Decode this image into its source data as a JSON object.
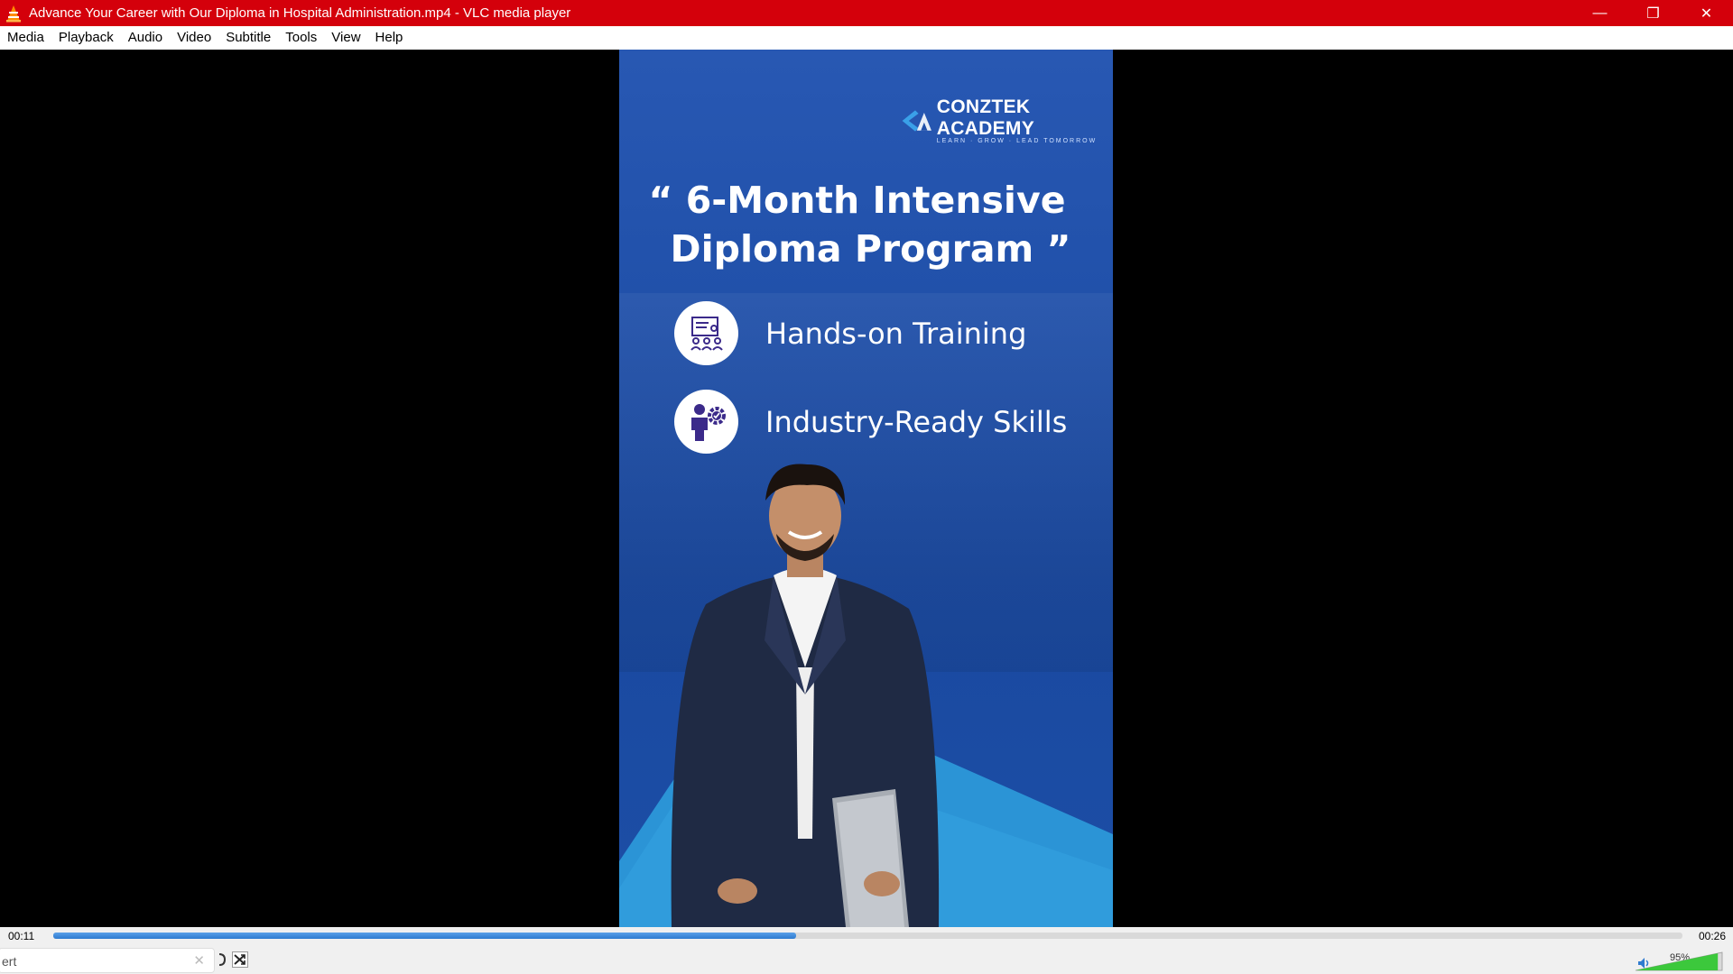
{
  "window": {
    "title": "Advance Your Career with Our Diploma in Hospital Administration.mp4 - VLC media player",
    "controls": {
      "minimize": "—",
      "restore": "❐",
      "close": "✕"
    }
  },
  "menu": [
    "Media",
    "Playback",
    "Audio",
    "Video",
    "Subtitle",
    "Tools",
    "View",
    "Help"
  ],
  "video": {
    "brand_name": "CONZTEK ACADEMY",
    "brand_tagline": "LEARN · GROW · LEAD TOMORROW",
    "headline_line1": "“ 6-Month Intensive",
    "headline_line2": "Diploma Program ”",
    "features": [
      {
        "icon": "training-presentation-icon",
        "label": "Hands-on Training"
      },
      {
        "icon": "person-gear-skills-icon",
        "label": "Industry-Ready Skills"
      }
    ]
  },
  "playback": {
    "current_time": "00:11",
    "total_time": "00:26",
    "progress_fraction": 0.456
  },
  "bottom": {
    "search_text": "ert",
    "volume_label": "95%",
    "volume_fraction": 0.95
  },
  "colors": {
    "titlebar": "#d4000b",
    "video_bg": "#1f4fa8",
    "seek_fill": "#2f7bd0"
  }
}
